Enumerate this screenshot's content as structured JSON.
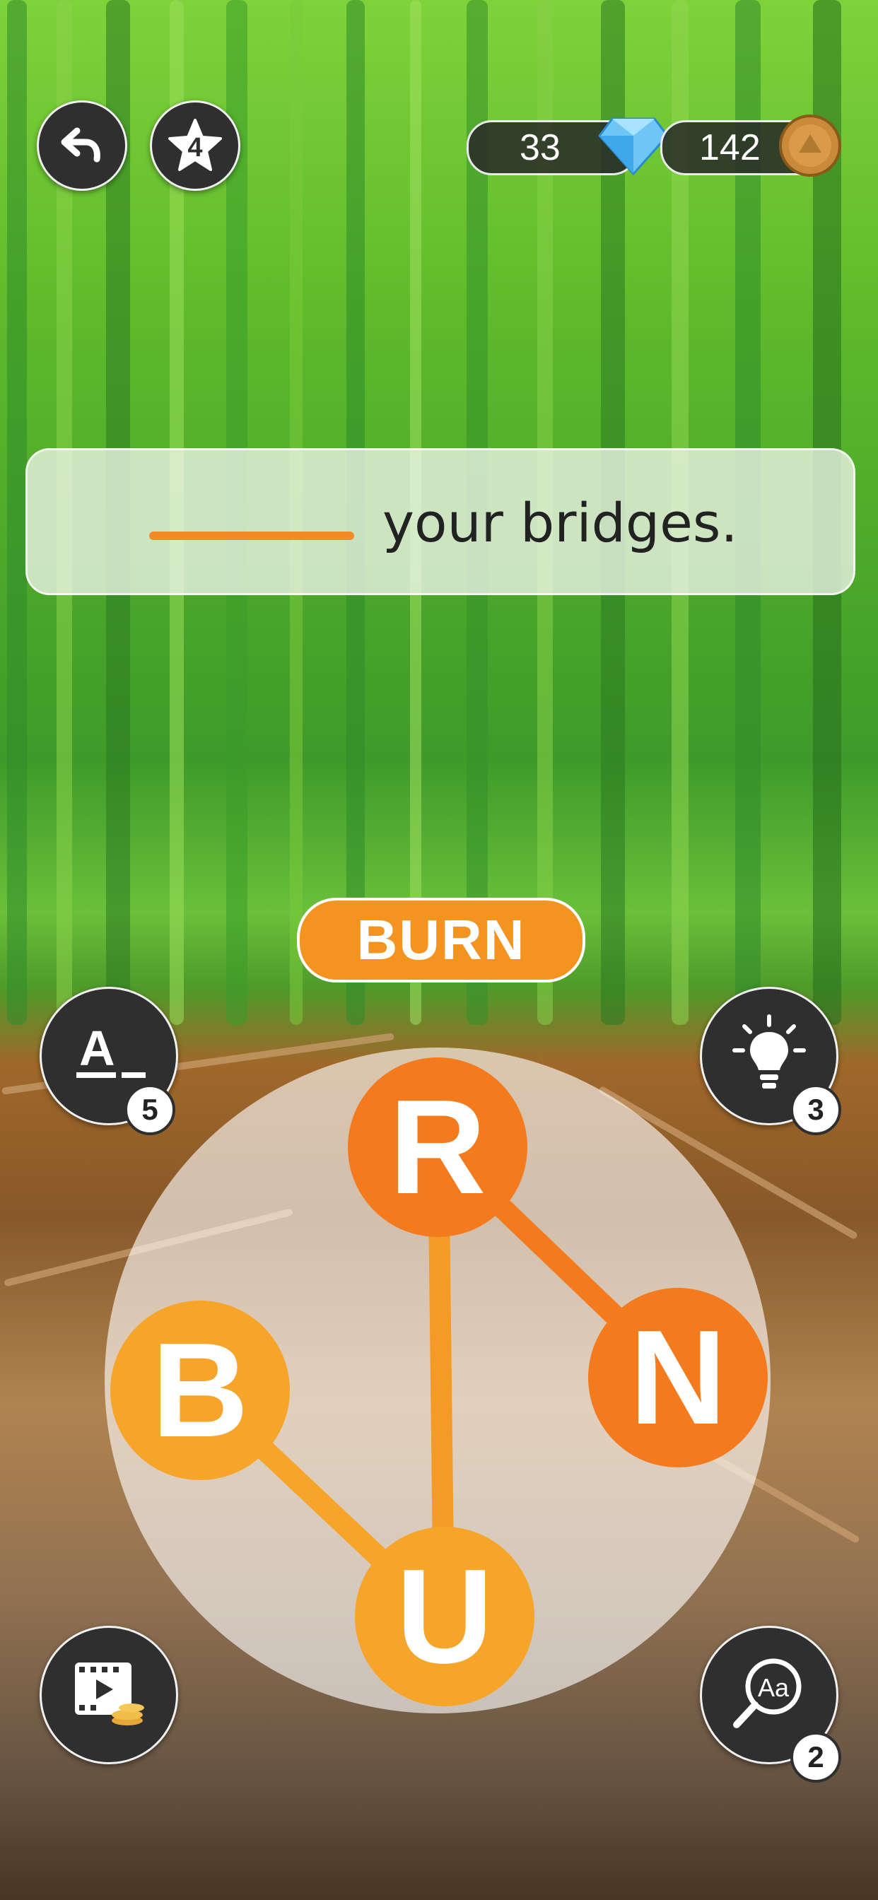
{
  "top_bar": {
    "back_button": {
      "icon": "undo-arrow-icon"
    },
    "level_star": {
      "icon": "star-icon",
      "value": "4"
    },
    "gems": {
      "value": "33",
      "icon": "diamond-icon"
    },
    "coins": {
      "value": "142",
      "icon": "coin-icon"
    }
  },
  "puzzle": {
    "phrase_text": "your bridges.",
    "blank_color": "#f28a25"
  },
  "current_word": "BURN",
  "wheel": {
    "letters": [
      "R",
      "N",
      "B",
      "U"
    ],
    "colors": {
      "R": "#f47a1e",
      "N": "#f47a1e",
      "B": "#f7a52a",
      "U": "#f7a52a"
    }
  },
  "powerups": {
    "reveal_letter": {
      "icon": "letter-reveal-icon",
      "count": "5"
    },
    "hint": {
      "icon": "lightbulb-icon",
      "count": "3"
    },
    "video": {
      "icon": "video-coins-icon"
    },
    "dictionary": {
      "icon": "search-aa-icon",
      "count": "2"
    }
  },
  "colors": {
    "accent": "#f39420",
    "dark_button": "#2f2f2f"
  }
}
